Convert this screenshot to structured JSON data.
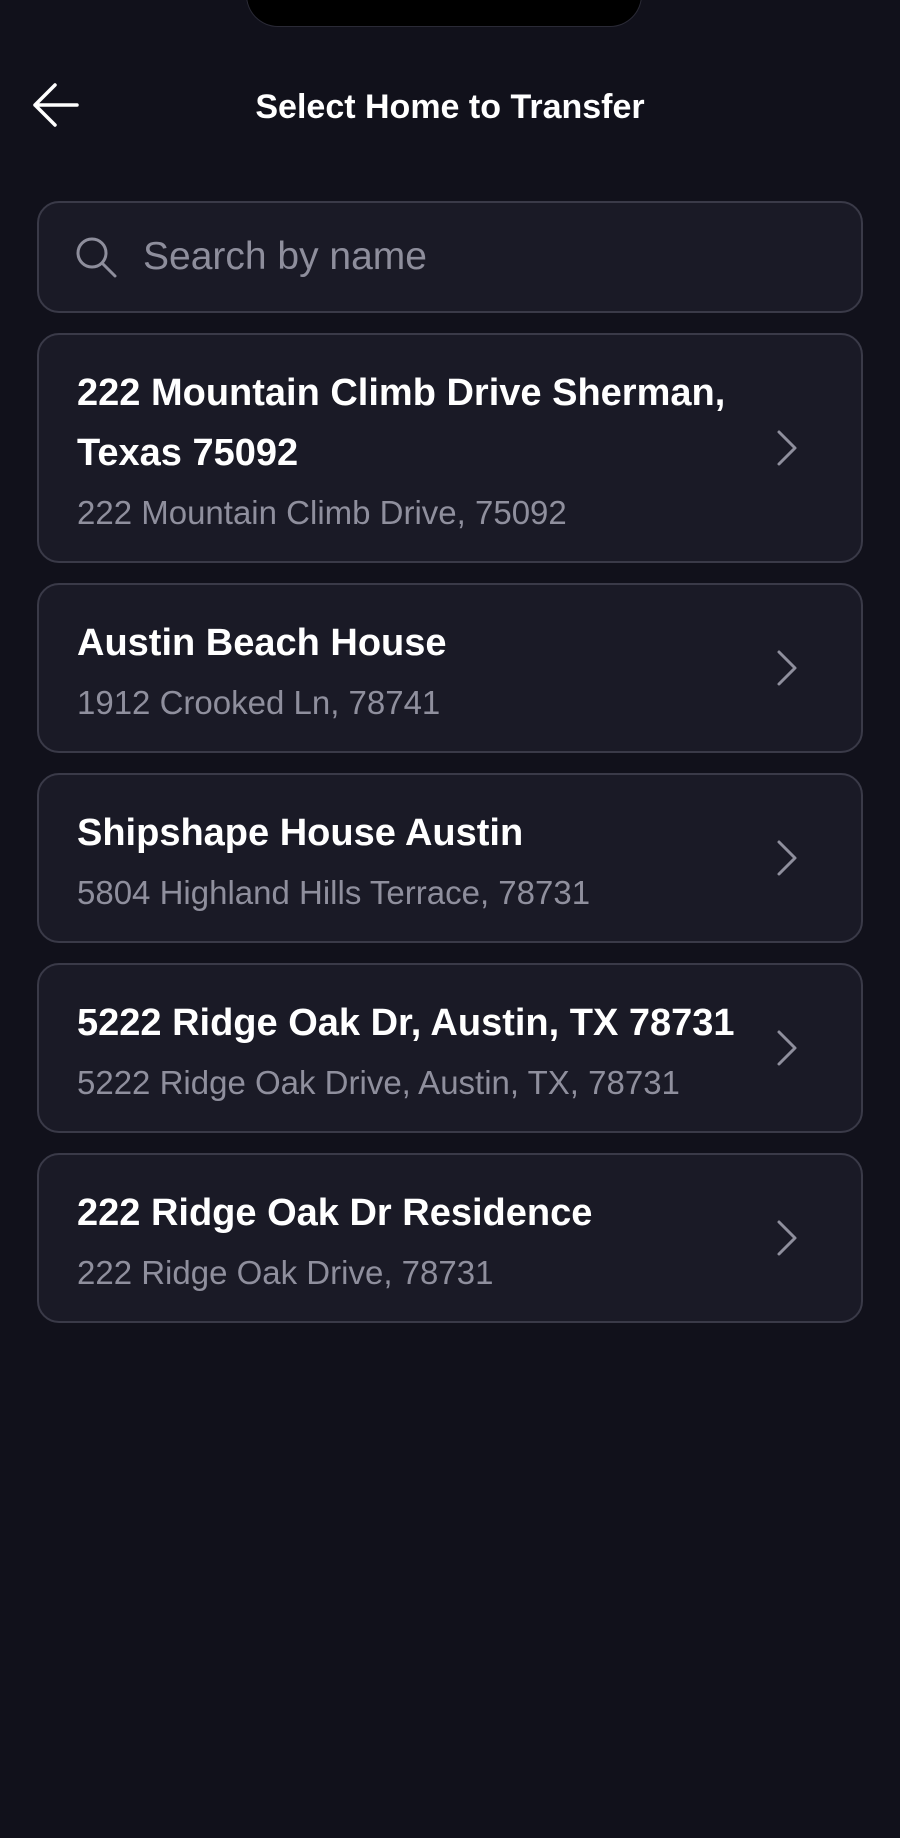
{
  "header": {
    "title": "Select Home to Transfer"
  },
  "search": {
    "placeholder": "Search by name",
    "value": ""
  },
  "homes": [
    {
      "name": "222 Mountain Climb Drive Sherman, Texas 75092",
      "address": "222 Mountain Climb Drive, 75092"
    },
    {
      "name": "Austin Beach House",
      "address": "1912 Crooked Ln, 78741"
    },
    {
      "name": "Shipshape House Austin",
      "address": "5804 Highland Hills Terrace, 78731"
    },
    {
      "name": "5222 Ridge Oak Dr, Austin, TX 78731",
      "address": "5222 Ridge Oak Drive, Austin, TX, 78731"
    },
    {
      "name": "222 Ridge Oak Dr Residence",
      "address": "222 Ridge Oak Drive, 78731"
    }
  ],
  "icons": {
    "back": "arrow-left-icon",
    "search": "search-icon",
    "row_chevron": "chevron-right-icon"
  },
  "colors": {
    "background": "#11111b",
    "card_background": "#1a1a26",
    "card_border": "#3a3a48",
    "primary_text": "#ffffff",
    "secondary_text": "#8f8f9d"
  }
}
